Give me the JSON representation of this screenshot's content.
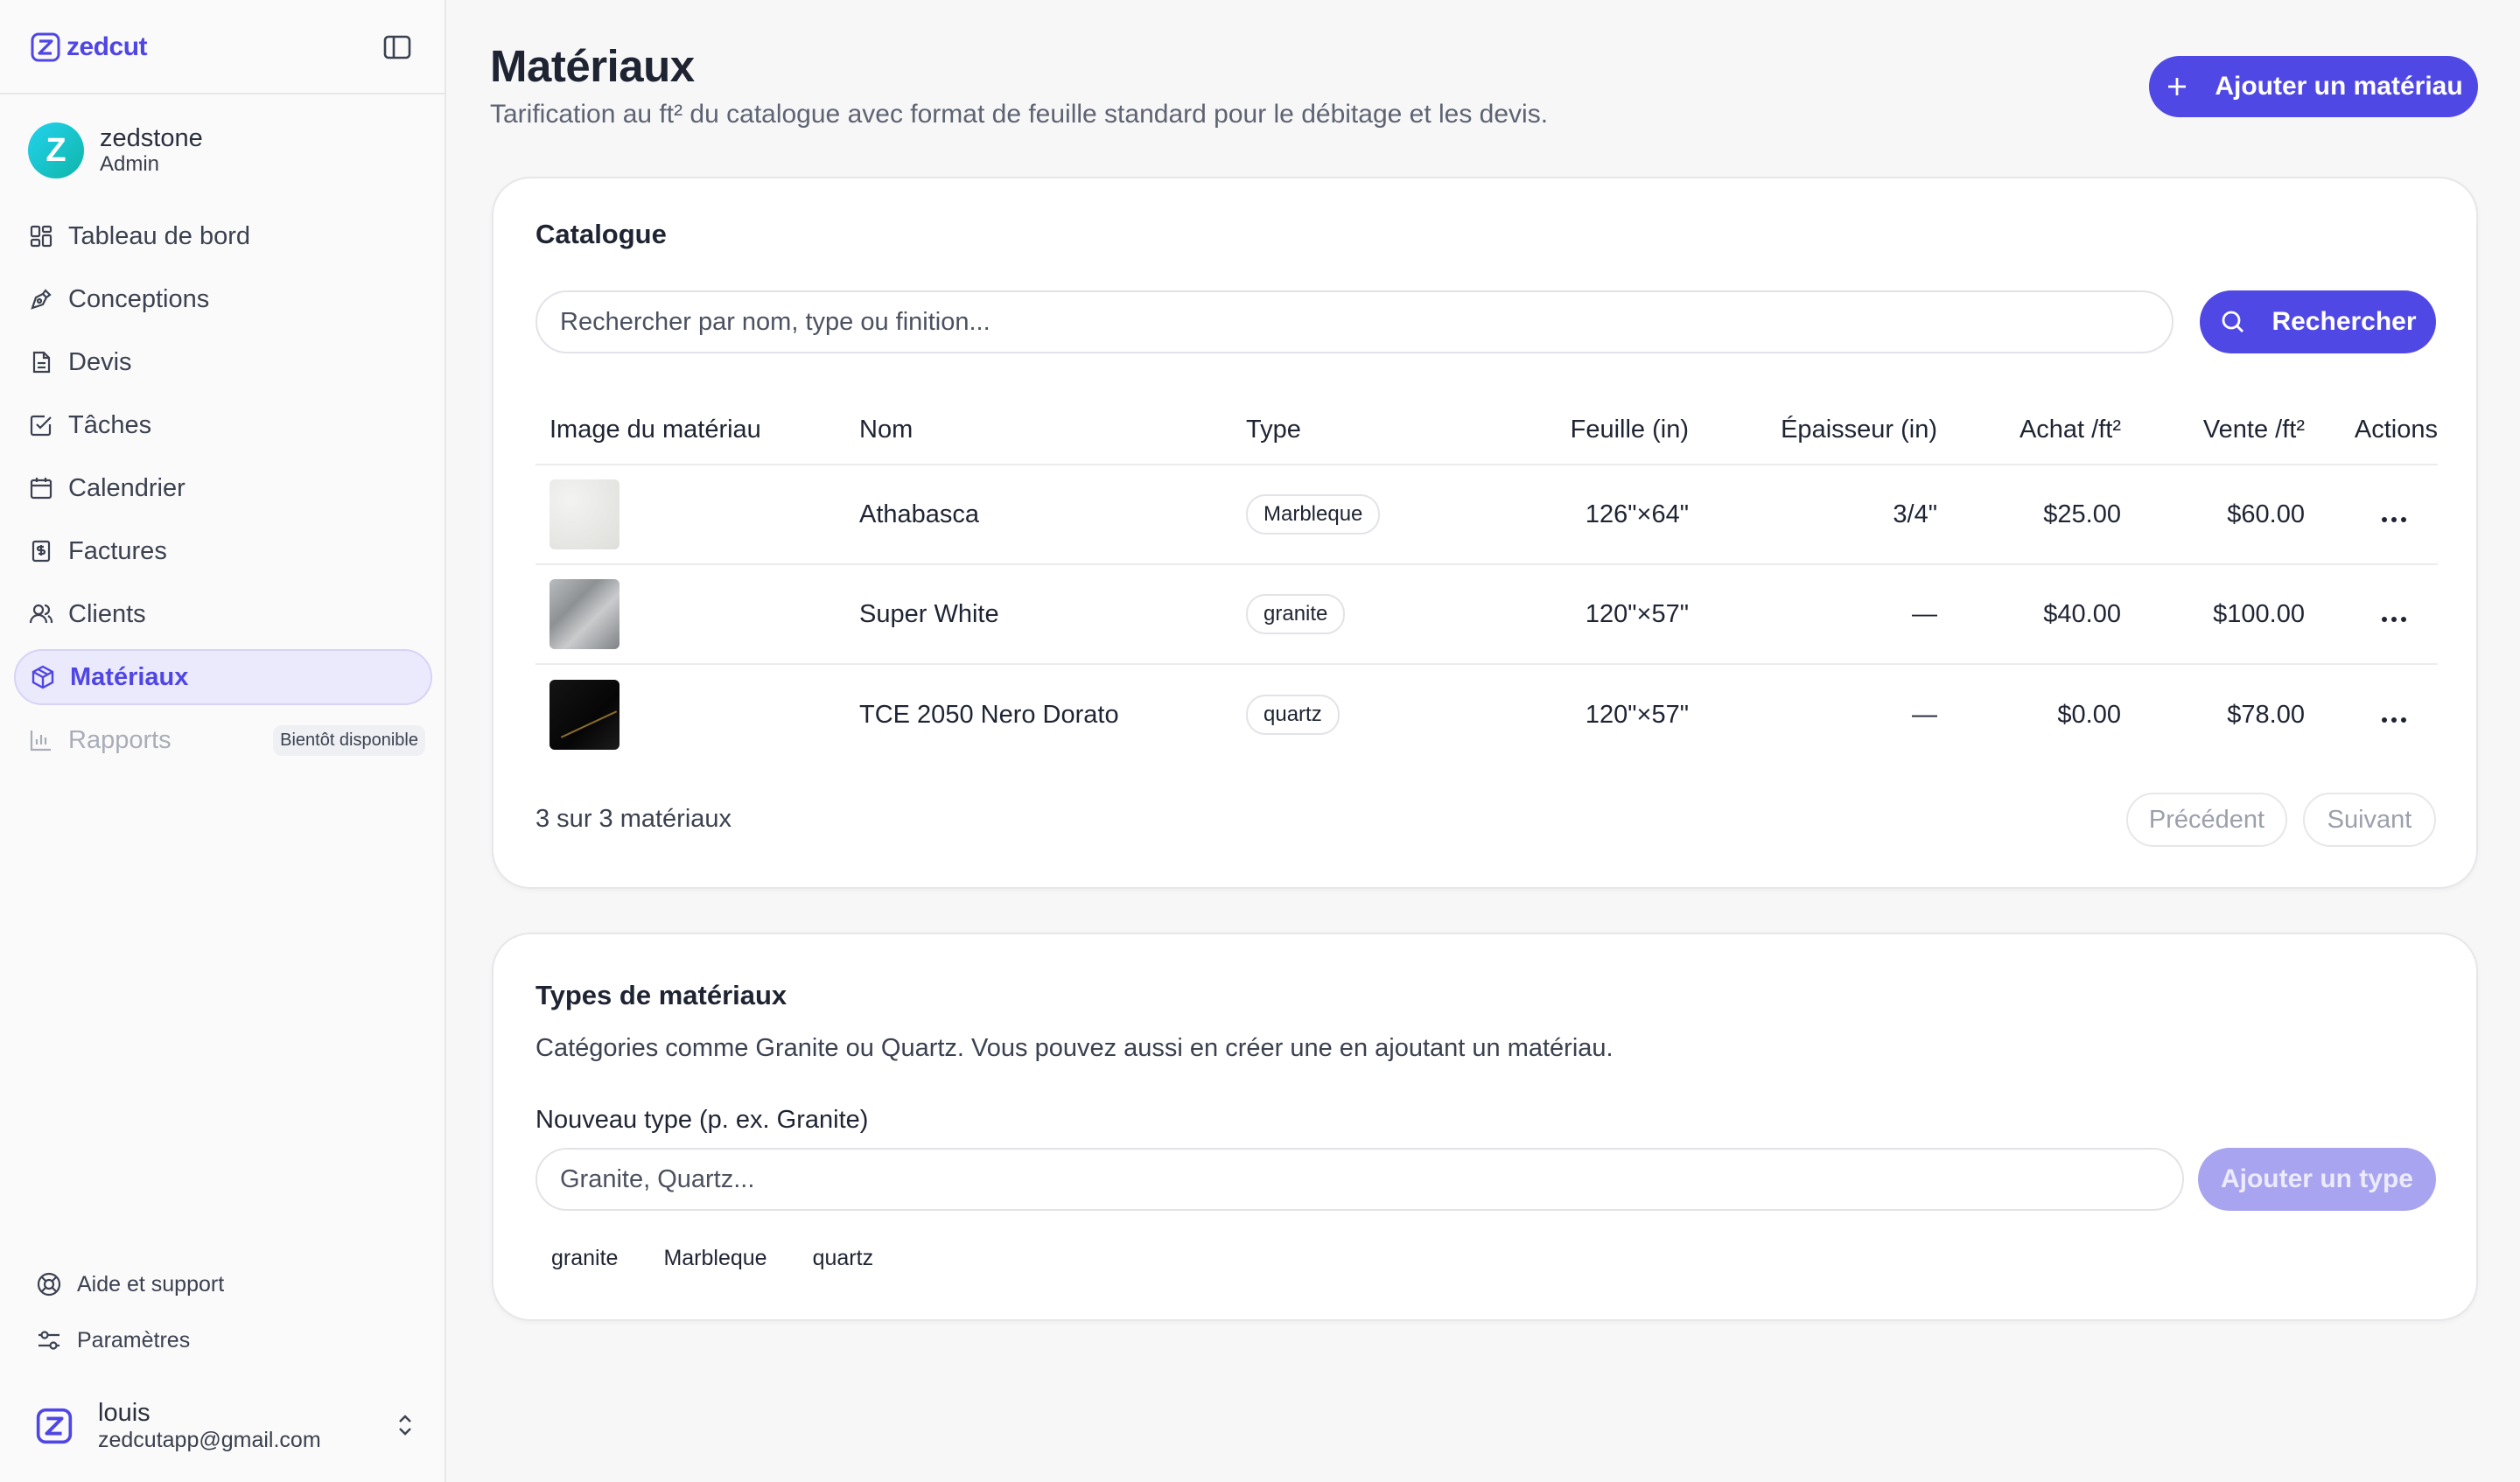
{
  "app": {
    "brand": "zedcut",
    "accent_color": "#5048e5"
  },
  "sidebar": {
    "org": {
      "initial": "Z",
      "name": "zedstone",
      "role": "Admin"
    },
    "items": [
      {
        "label": "Tableau de bord",
        "icon": "dashboard-icon"
      },
      {
        "label": "Conceptions",
        "icon": "pen-tool-icon"
      },
      {
        "label": "Devis",
        "icon": "document-icon"
      },
      {
        "label": "Tâches",
        "icon": "checkbox-icon"
      },
      {
        "label": "Calendrier",
        "icon": "calendar-icon"
      },
      {
        "label": "Factures",
        "icon": "invoice-dollar-icon"
      },
      {
        "label": "Clients",
        "icon": "users-icon"
      },
      {
        "label": "Matériaux",
        "icon": "box-icon",
        "active": true
      },
      {
        "label": "Rapports",
        "icon": "bar-chart-icon",
        "disabled": true,
        "badge": "Bientôt disponible"
      }
    ],
    "help": "Aide et support",
    "settings": "Paramètres",
    "user": {
      "name": "louis",
      "email": "zedcutapp@gmail.com"
    }
  },
  "page": {
    "title": "Matériaux",
    "subtitle": "Tarification au ft² du catalogue avec format de feuille standard pour le débitage et les devis.",
    "add_button": "Ajouter un matériau"
  },
  "catalog": {
    "title": "Catalogue",
    "search_placeholder": "Rechercher par nom, type ou finition...",
    "search_button": "Rechercher",
    "columns": [
      "Image du matériau",
      "Nom",
      "Type",
      "Feuille (in)",
      "Épaisseur (in)",
      "Achat /ft²",
      "Vente /ft²",
      "Actions"
    ],
    "rows": [
      {
        "name": "Athabasca",
        "type": "Marbleque",
        "sheet": "126\"×64\"",
        "thickness": "3/4\"",
        "buy": "$25.00",
        "sell": "$60.00"
      },
      {
        "name": "Super White",
        "type": "granite",
        "sheet": "120\"×57\"",
        "thickness": "—",
        "buy": "$40.00",
        "sell": "$100.00"
      },
      {
        "name": "TCE 2050 Nero Dorato",
        "type": "quartz",
        "sheet": "120\"×57\"",
        "thickness": "—",
        "buy": "$0.00",
        "sell": "$78.00"
      }
    ],
    "count_text": "3 sur 3 matériaux",
    "prev": "Précédent",
    "next": "Suivant"
  },
  "types": {
    "title": "Types de matériaux",
    "description": "Catégories comme Granite ou Quartz. Vous pouvez aussi en créer une en ajoutant un matériau.",
    "new_label": "Nouveau type (p. ex. Granite)",
    "placeholder": "Granite, Quartz...",
    "add_button": "Ajouter un type",
    "chips": [
      "granite",
      "Marbleque",
      "quartz"
    ]
  }
}
